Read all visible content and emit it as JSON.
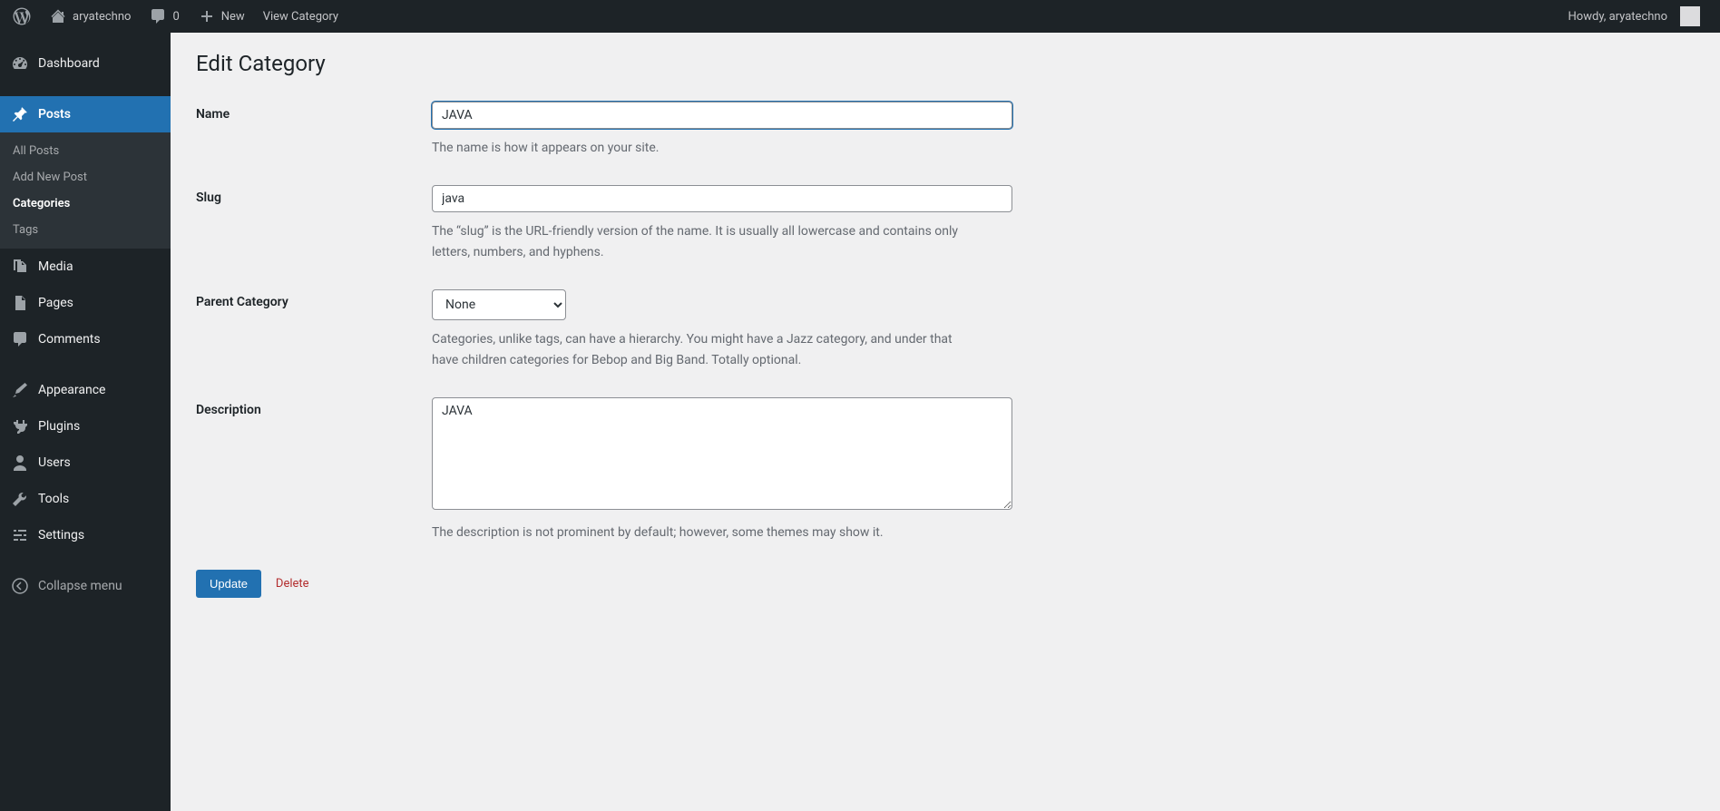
{
  "adminbar": {
    "site_name": "aryatechno",
    "comment_count": "0",
    "new_label": "New",
    "view_label": "View Category",
    "howdy": "Howdy, aryatechno"
  },
  "sidebar": {
    "dashboard": "Dashboard",
    "posts": "Posts",
    "posts_sub": {
      "all": "All Posts",
      "add": "Add New Post",
      "categories": "Categories",
      "tags": "Tags"
    },
    "media": "Media",
    "pages": "Pages",
    "comments": "Comments",
    "appearance": "Appearance",
    "plugins": "Plugins",
    "users": "Users",
    "tools": "Tools",
    "settings": "Settings",
    "collapse": "Collapse menu"
  },
  "page": {
    "title": "Edit Category"
  },
  "form": {
    "name": {
      "label": "Name",
      "value": "JAVA",
      "desc": "The name is how it appears on your site."
    },
    "slug": {
      "label": "Slug",
      "value": "java",
      "desc": "The “slug” is the URL-friendly version of the name. It is usually all lowercase and contains only letters, numbers, and hyphens."
    },
    "parent": {
      "label": "Parent Category",
      "selected": "None",
      "desc": "Categories, unlike tags, can have a hierarchy. You might have a Jazz category, and under that have children categories for Bebop and Big Band. Totally optional."
    },
    "description": {
      "label": "Description",
      "value": "JAVA",
      "desc": "The description is not prominent by default; however, some themes may show it."
    }
  },
  "actions": {
    "update": "Update",
    "delete": "Delete"
  }
}
